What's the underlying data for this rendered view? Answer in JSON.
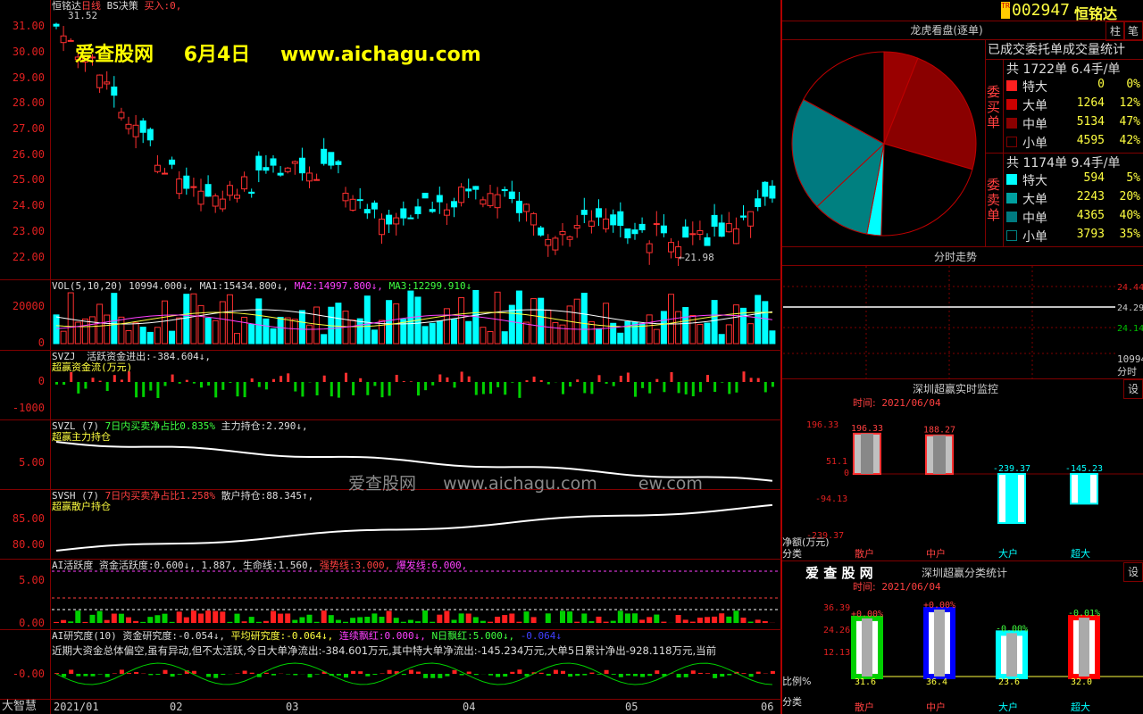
{
  "stock": {
    "code": "002947",
    "name": "恒铭达",
    "tag": "TR"
  },
  "main": {
    "header_name": "恒铭达",
    "header_period": "日线",
    "header_indicator": "BS决策",
    "header_buy_label": "买入:",
    "header_buy_value": "0,",
    "high_label": "31.52",
    "low_label": "21.98",
    "watermark_site": "爱查股网",
    "watermark_date": "6月4日",
    "watermark_url": "www.aichagu.com",
    "yaxis": [
      "31.00",
      "30.00",
      "29.00",
      "28.00",
      "27.00",
      "26.00",
      "25.00",
      "24.00",
      "23.00",
      "22.00"
    ]
  },
  "vol": {
    "name": "VOL(5,10,20)",
    "value": "10994.000↓,",
    "ma1_label": "MA1:",
    "ma1": "15434.800↓,",
    "ma2_label": "MA2:",
    "ma2": "14997.800↓,",
    "ma3_label": "MA3:",
    "ma3": "12299.910↓",
    "yaxis": [
      "20000",
      "10000",
      "0"
    ]
  },
  "svzj": {
    "name": "SVZJ",
    "label": "活跃资金进出:",
    "value": "-384.604↓,",
    "sub": "超赢资金流(万元)",
    "yaxis": [
      "0",
      "-1000"
    ]
  },
  "svzl": {
    "name": "SVZL (7)",
    "net_label": "7日内买卖净占比",
    "net_value": "0.835%",
    "hold_label": "主力持仓:",
    "hold_value": "2.290↓,",
    "sub": "超赢主力持仓",
    "yaxis": [
      "5.00"
    ]
  },
  "svsh": {
    "name": "SVSH (7)",
    "net_label": "7日内买卖净占比",
    "net_value": "1.258%",
    "hold_label": "散户持仓:",
    "hold_value": "88.345↑,",
    "sub": "超赢散户持仓",
    "yaxis": [
      "85.00",
      "80.00"
    ]
  },
  "ai_active": {
    "name": "AI活跃度",
    "l1": "资金活跃度:",
    "v1": "0.600↓,",
    "v2": "1.887,",
    "l3": "生命线:",
    "v3": "1.560,",
    "l4": "强势线:",
    "v4": "3.000,",
    "l5": "爆发线:",
    "v5": "6.000,",
    "yaxis": [
      "5.00",
      "0.00"
    ]
  },
  "ai_research": {
    "name": "AI研究度(10)",
    "l1": "资金研究度:",
    "v1": "-0.054↓,",
    "l2": "平均研究度:",
    "v2": "-0.064↓,",
    "l3": "连续飘红:",
    "v3": "0.000↓,",
    "l4": "N日飘红:",
    "v4": "5.000↓,",
    "v5": "-0.064↓",
    "comment": "近期大资金总体偏空,虽有异动,但不太活跃,今日大单净流出:-384.601万元,其中特大单净流出:-145.234万元,大单5日累计净出-928.118万元,当前",
    "yaxis": [
      "-0.00"
    ]
  },
  "watermark2": {
    "site": "爱查股网",
    "url": "www.aichagu.com",
    "tail": "ew.com"
  },
  "xaxis": [
    "2021/01",
    "02",
    "03",
    "04",
    "05",
    "06"
  ],
  "app_logo": "大智慧",
  "buttons": {
    "pin": "柱",
    "settings": "笔",
    "set1": "设",
    "set2": "设"
  },
  "lhb": {
    "title": "龙虎看盘(逐单)",
    "subtitle": "已成交委托单成交量统计"
  },
  "buy": {
    "side_label": "委买单",
    "total": "共 1722单 6.4手/单",
    "rows": [
      {
        "name": "特大",
        "value": "0",
        "pct": "0%",
        "color": "#ff2020"
      },
      {
        "name": "大单",
        "value": "1264",
        "pct": "12%",
        "color": "#cc0000"
      },
      {
        "name": "中单",
        "value": "5134",
        "pct": "47%",
        "color": "#8a0000"
      },
      {
        "name": "小单",
        "value": "4595",
        "pct": "42%",
        "color": "#000000"
      }
    ]
  },
  "sell": {
    "side_label": "委卖单",
    "total": "共 1174单 9.4手/单",
    "rows": [
      {
        "name": "特大",
        "value": "594",
        "pct": "5%",
        "color": "#00ffff"
      },
      {
        "name": "大单",
        "value": "2243",
        "pct": "20%",
        "color": "#00a0a0"
      },
      {
        "name": "中单",
        "value": "4365",
        "pct": "40%",
        "color": "#007a80"
      },
      {
        "name": "小单",
        "value": "3793",
        "pct": "35%",
        "color": "#000000"
      }
    ]
  },
  "pie_data": [
    {
      "name": "委买-特大",
      "pct": 0,
      "color": "#ff2020"
    },
    {
      "name": "委买-大单",
      "pct": 6,
      "color": "#990000"
    },
    {
      "name": "委买-中单",
      "pct": 23.5,
      "color": "#8a0000"
    },
    {
      "name": "委买-小单",
      "pct": 21,
      "color": "#000000"
    },
    {
      "name": "委卖-特大",
      "pct": 2.5,
      "color": "#00ffff"
    },
    {
      "name": "委卖-大单",
      "pct": 10,
      "color": "#008080"
    },
    {
      "name": "委卖-中单",
      "pct": 20,
      "color": "#007a80"
    },
    {
      "name": "委卖-小单",
      "pct": 17,
      "color": "#000000"
    }
  ],
  "intraday": {
    "title": "分时走势",
    "yaxis": [
      "24.44",
      "24.29",
      "24.14"
    ],
    "vol": "10994",
    "vol_label": "分时"
  },
  "monitor": {
    "title": "深圳超赢实时监控",
    "time_label": "时间:",
    "time": "2021/06/04",
    "yaxis": [
      "196.33",
      "51.1",
      "0",
      "-94.13",
      "-239.37"
    ],
    "unit": "净额(万元)",
    "cat_label": "分类",
    "bars": [
      {
        "cat": "散户",
        "value": 196.33,
        "label": "196.33",
        "color": "#aaaaaa"
      },
      {
        "cat": "中户",
        "value": 188.27,
        "label": "188.27",
        "color": "#aaaaaa"
      },
      {
        "cat": "大户",
        "value": -239.37,
        "label": "-239.37",
        "color": "#00ffff"
      },
      {
        "cat": "超大",
        "value": -145.23,
        "label": "-145.23",
        "color": "#00ffff"
      }
    ]
  },
  "classify": {
    "brand": "爱 查 股 网",
    "title": "深圳超赢分类统计",
    "time_label": "时间:",
    "time": "2021/06/04",
    "yaxis": [
      "36.39",
      "24.26",
      "12.13",
      "0"
    ],
    "ratio_label": "比例%",
    "cat_label": "分类",
    "bars": [
      {
        "cat": "散户",
        "value": 31.6,
        "label": "31.6",
        "change": "+0.00%",
        "color": "#00d000"
      },
      {
        "cat": "中户",
        "value": 36.4,
        "label": "36.4",
        "change": "+0.00%",
        "color": "#0000ff"
      },
      {
        "cat": "大户",
        "value": 23.6,
        "label": "23.6",
        "change": "-0.00%",
        "color": "#00ffff"
      },
      {
        "cat": "超大",
        "value": 32.0,
        "label": "32.0",
        "change": "-0.01%",
        "color": "#ff0000"
      }
    ]
  }
}
